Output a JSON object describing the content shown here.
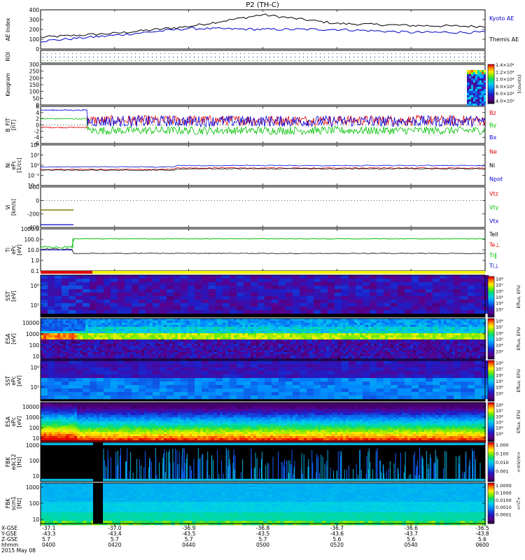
{
  "title": "P2 (TH-C)",
  "date_label": "2015 May 08",
  "colors": {
    "kyoto": "#000000",
    "themis": "#0000c8",
    "bz": "#e00000",
    "by": "#00c000",
    "bx": "#0000e0",
    "roi_bar_red": "#e00000",
    "roi_bar_yellow": "#f4f400"
  },
  "panels": {
    "ae": {
      "ylabel": "AE Index",
      "ylim": [
        0,
        400
      ],
      "yticks": [
        "0",
        "100",
        "200",
        "300",
        "400"
      ],
      "legend": [
        "Kyoto AE",
        "Themis AE"
      ]
    },
    "roi": {
      "ylabel": "ROI"
    },
    "keogram": {
      "ylabel": "Keogram",
      "ylim": [
        0,
        300
      ],
      "yticks": [
        "0",
        "50",
        "100",
        "150",
        "200",
        "250",
        "300"
      ],
      "cbar_ticks": [
        "1.4×10⁴",
        "1.2×10⁴",
        "1.0×10⁴",
        "8.0×10³",
        "6.0×10³",
        "4.0×10³"
      ],
      "cbar_unit": "[counts]"
    },
    "bfield": {
      "ylabel": [
        "B_FIT",
        "[nT]"
      ],
      "yticks": [
        "6",
        "4",
        "2",
        "0",
        "-2",
        "-4",
        "-6"
      ],
      "legend": [
        "Bz",
        "By",
        "Bx"
      ]
    },
    "density": {
      "ylabel": [
        "Ni",
        "ePc",
        "[1/cc]"
      ],
      "yticks": [
        "10⁴",
        "10²",
        "10⁰",
        "10⁻²",
        "10⁻⁴"
      ],
      "legend": [
        "Ne",
        "Ni",
        "Npot"
      ]
    },
    "velocity": {
      "ylabel": [
        "Vi",
        "[km/s]"
      ],
      "yticks": [
        "200",
        "0",
        "-200",
        "-400"
      ],
      "legend": [
        "Vtz",
        "Vty",
        "Vtx"
      ]
    },
    "temperature": {
      "ylabel": [
        "Ti",
        "ePc",
        "[eV]"
      ],
      "yticks": [
        "1000.0",
        "100.0",
        "10.0",
        "1.0",
        "0.1"
      ],
      "legend": [
        "Tell",
        "Te⊥",
        "Ti‖",
        "Ti⊥"
      ]
    },
    "sst_ion": {
      "ylabel": [
        "SST",
        "[eV]"
      ],
      "yticks": [
        "10⁶",
        "10⁵"
      ],
      "cbar": "Eflux, EFU"
    },
    "esa_ion": {
      "ylabel": [
        "ESA",
        "[eV]"
      ],
      "yticks": [
        "10000",
        "1000",
        "100",
        "10"
      ],
      "cbar": "Eflux, EFU"
    },
    "sst_ele": {
      "ylabel": [
        "SST",
        "ePc",
        "[eV]"
      ],
      "yticks": [
        "10⁶",
        "10⁵"
      ],
      "cbar": "Eflux, EFU"
    },
    "esa_ele": {
      "ylabel": [
        "ESA",
        "ePc",
        "[eV]"
      ],
      "yticks": [
        "10000",
        "1000",
        "100",
        "10"
      ],
      "cbar": "Eflux, EFU"
    },
    "fbk_e": {
      "ylabel": [
        "FBK",
        "edc12",
        "[Hz]"
      ],
      "yticks": [
        "1000",
        "100",
        "10"
      ],
      "cbar_ticks": [
        "1.000",
        "0.100",
        "0.010",
        "0.001"
      ],
      "cbar_unit": "<mV/m>"
    },
    "fbk_b": {
      "ylabel": [
        "FBK",
        "scm1",
        "[Hz]"
      ],
      "yticks": [
        "1000",
        "100",
        "10"
      ],
      "cbar_ticks": [
        "1.0000",
        "0.1000",
        "0.0100",
        "0.0010",
        "0.0001"
      ],
      "cbar_unit": "<nT>"
    },
    "eflux_cbar_ticks": [
      "10⁸",
      "10⁷",
      "10⁶",
      "10⁵",
      "10⁴",
      "10³"
    ]
  },
  "x_axis": {
    "row_labels": [
      "X-GSE",
      "Y-GSE",
      "Z-GSE",
      "hhmm"
    ],
    "columns": [
      {
        "x": "-37.1",
        "y": "-43.3",
        "z": "5.7",
        "t": "0400"
      },
      {
        "x": "-37.0",
        "y": "-43.4",
        "z": "5.7",
        "t": "0420"
      },
      {
        "x": "-36.9",
        "y": "-43.5",
        "z": "5.7",
        "t": "0440"
      },
      {
        "x": "-36.8",
        "y": "-43.5",
        "z": "5.7",
        "t": "0500"
      },
      {
        "x": "-36.7",
        "y": "-43.6",
        "z": "5.6",
        "t": "0520"
      },
      {
        "x": "-36.6",
        "y": "-43.7",
        "z": "5.6",
        "t": "0540"
      },
      {
        "x": "-36.5",
        "y": "-43.8",
        "z": "5.6",
        "t": "0600"
      }
    ]
  },
  "chart_data": {
    "type": "line",
    "title": "P2 (TH-C)",
    "x": [
      "0400",
      "0420",
      "0440",
      "0500",
      "0520",
      "0540",
      "0600"
    ],
    "series": [
      {
        "name": "Kyoto AE",
        "values": [
          120,
          160,
          230,
          350,
          260,
          240,
          230
        ]
      },
      {
        "name": "Themis AE",
        "values": [
          80,
          140,
          210,
          200,
          200,
          170,
          170
        ]
      }
    ],
    "ylabel": "AE Index",
    "ylim": [
      0,
      400
    ]
  }
}
